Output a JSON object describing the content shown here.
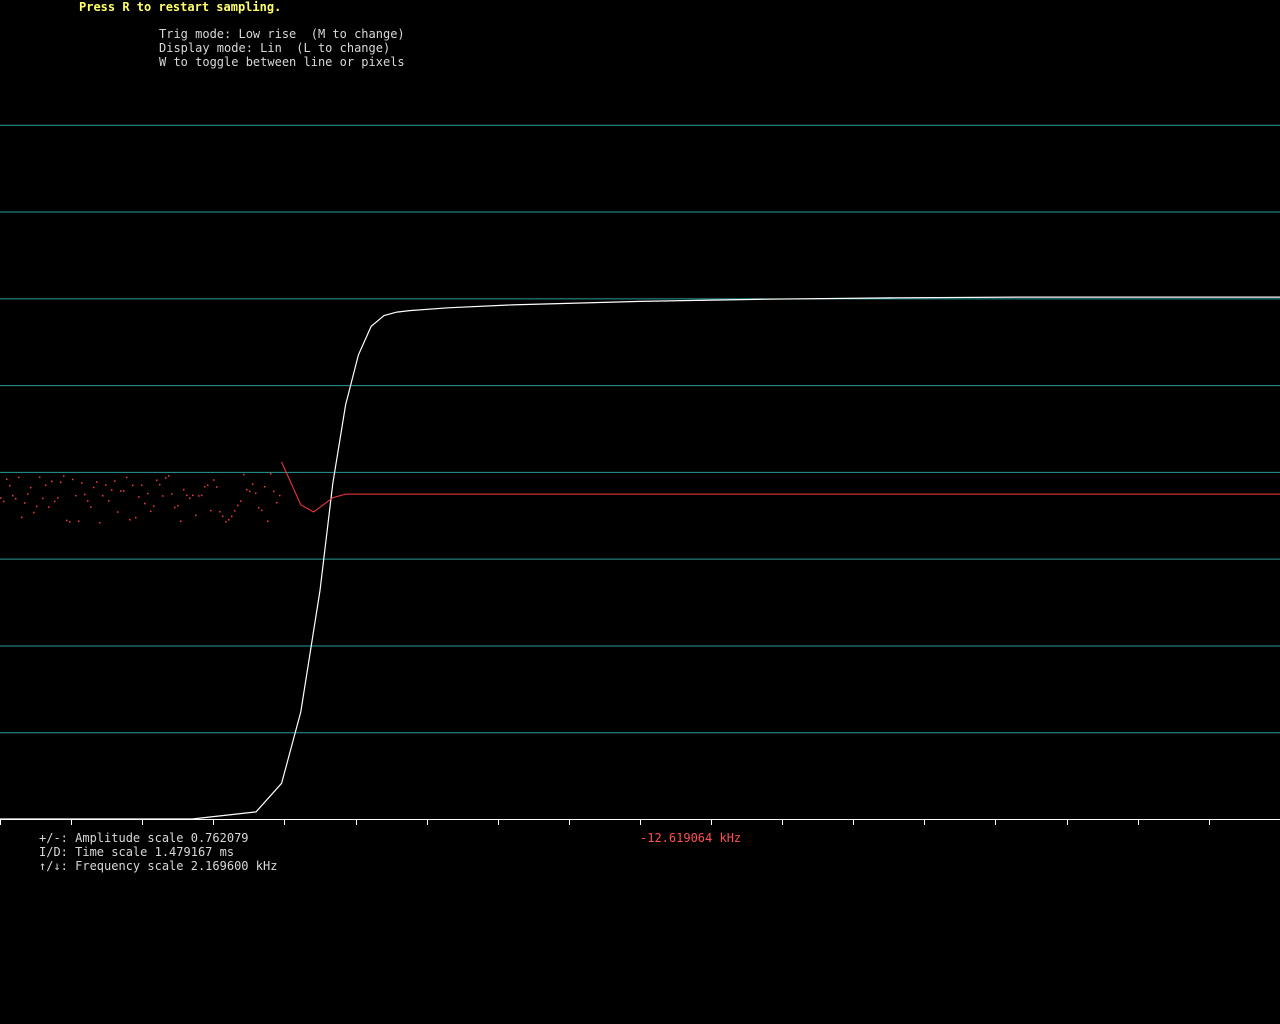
{
  "app": {
    "restart_hint": "Press R to restart sampling.",
    "trig_mode_line": "Trig mode: Low rise  (M to change)",
    "display_mode_line": "Display mode: Lin  (L to change)",
    "draw_mode_line": "W to toggle between line or pixels",
    "amplitude_line": "+/-: Amplitude scale 0.762079",
    "time_line": "I/D: Time scale 1.479167 ms",
    "frequency_line": "↑/↓: Frequency scale 2.169600 kHz",
    "frequency_readout": "-12.619064 kHz"
  },
  "colors": {
    "background": "#000000",
    "hint_text": "#ffff66",
    "info_text": "#d8d8d8",
    "frequency_text": "#ff5050",
    "grid": "#2a9a9a",
    "trace_time": "#ffffff",
    "trace_freq": "#ff3a3a",
    "axis": "#ffffff"
  },
  "scope": {
    "grid_divisions": 10,
    "ticks": 18
  },
  "chart_data": {
    "type": "line",
    "series": [
      {
        "x": [
          0,
          0.05,
          0.1,
          0.15,
          0.2,
          0.22,
          0.235,
          0.25,
          0.26,
          0.27,
          0.28,
          0.29,
          0.3,
          0.31,
          0.32,
          0.35,
          0.4,
          0.5,
          0.6,
          0.7,
          0.8,
          0.9,
          1.0
        ],
        "y": [
          0,
          0,
          0,
          0,
          0.01,
          0.05,
          0.15,
          0.32,
          0.47,
          0.58,
          0.65,
          0.69,
          0.705,
          0.71,
          0.712,
          0.716,
          0.72,
          0.725,
          0.728,
          0.73,
          0.731,
          0.731,
          0.731
        ]
      },
      {
        "x": [
          0,
          0.05,
          0.1,
          0.15,
          0.2,
          0.22,
          0.235,
          0.245,
          0.26,
          0.27,
          0.28,
          0.3,
          0.4,
          0.5,
          0.6,
          0.7,
          0.8,
          0.9,
          1.0
        ],
        "y": [
          0.45,
          0.45,
          0.45,
          0.45,
          0.46,
          0.5,
          0.44,
          0.43,
          0.45,
          0.455,
          0.455,
          0.455,
          0.455,
          0.455,
          0.455,
          0.455,
          0.455,
          0.455,
          0.455
        ],
        "noise_until": 0.22
      }
    ]
  }
}
